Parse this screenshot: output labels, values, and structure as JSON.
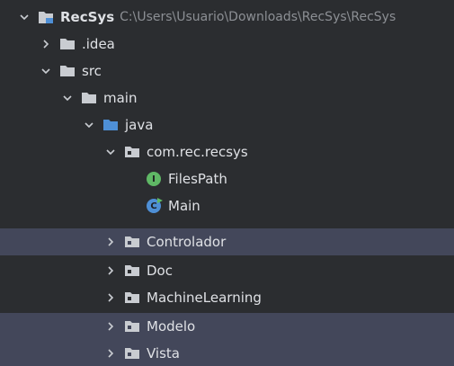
{
  "project": {
    "name": "RecSys",
    "path": "C:\\Users\\Usuario\\Downloads\\RecSys\\RecSys"
  },
  "tree": {
    "idea": ".idea",
    "src": "src",
    "main": "main",
    "java": "java",
    "package": "com.rec.recsys",
    "files_path": "FilesPath",
    "main_class": "Main",
    "controlador": "Controlador",
    "doc": "Doc",
    "machine_learning": "MachineLearning",
    "modelo": "Modelo",
    "vista": "Vista"
  },
  "icons": {
    "interface_letter": "I",
    "class_letter": "C"
  },
  "colors": {
    "background": "#2b2d30",
    "selection": "#43475a",
    "folder": "#c9ccd1",
    "source_folder": "#4e8fd6",
    "interface_icon": "#5fb865",
    "class_icon": "#4e8fd6"
  }
}
